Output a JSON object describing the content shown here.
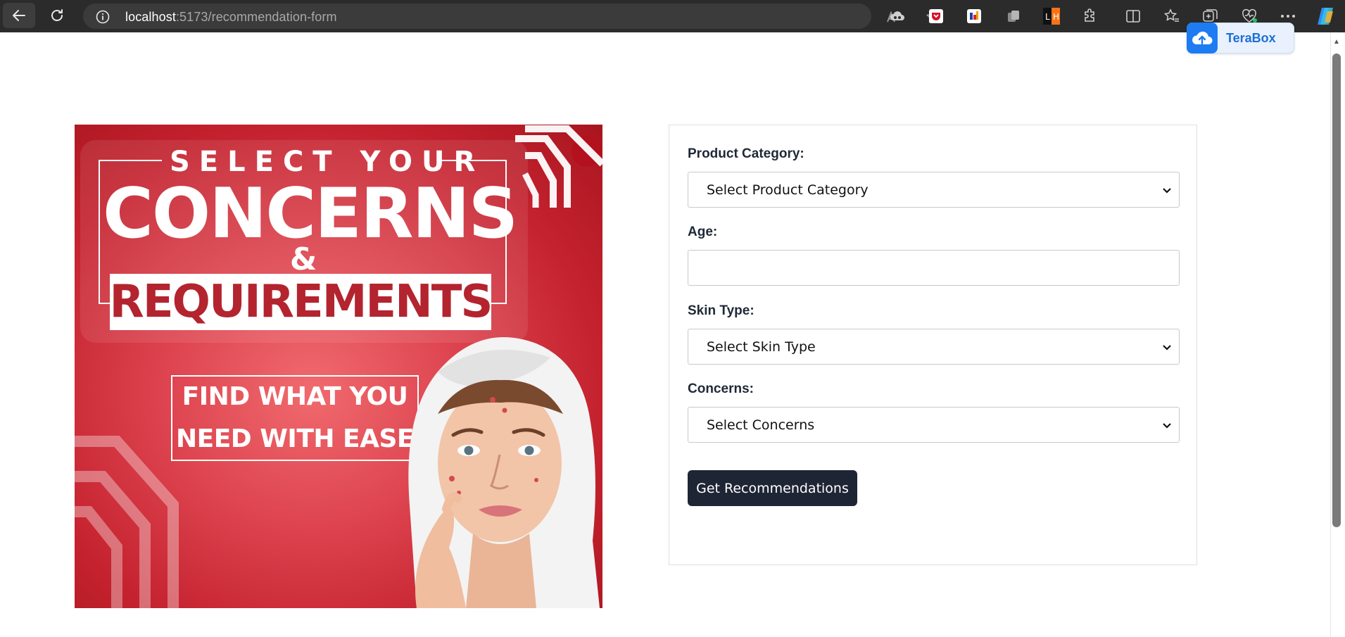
{
  "browser": {
    "url_host": "localhost",
    "url_path": ":5173/recommendation-form",
    "toolbar_icons": [
      "back-icon",
      "refresh-icon",
      "info-icon",
      "read-aloud-icon",
      "favorite-icon",
      "extensions-cloud-icon",
      "pocket-icon",
      "extension-icon",
      "collections-icon",
      "lh-extension-icon",
      "puzzle-icon",
      "split-screen-icon",
      "favorites-icon",
      "collections-add-icon",
      "health-icon",
      "more-icon",
      "copilot-icon"
    ],
    "lh_badge": "L H"
  },
  "terabox": {
    "label": "TeraBox",
    "color": "#1e7cf2"
  },
  "banner": {
    "line1": "SELECT YOUR",
    "line2": "CONCERNS",
    "line3": "&",
    "line4": "REQUIREMENTS",
    "tagline1": "FIND WHAT YOU",
    "tagline2": "NEED WITH EASE",
    "colors": {
      "primary_red": "#c4222e",
      "requirements_text": "#b3242f"
    }
  },
  "form": {
    "product_category": {
      "label": "Product Category:",
      "value": "Select Product Category"
    },
    "age": {
      "label": "Age:",
      "value": ""
    },
    "skin_type": {
      "label": "Skin Type:",
      "value": "Select Skin Type"
    },
    "concerns": {
      "label": "Concerns:",
      "value": "Select Concerns"
    },
    "submit_label": "Get Recommendations",
    "button_color": "#1e2535"
  }
}
